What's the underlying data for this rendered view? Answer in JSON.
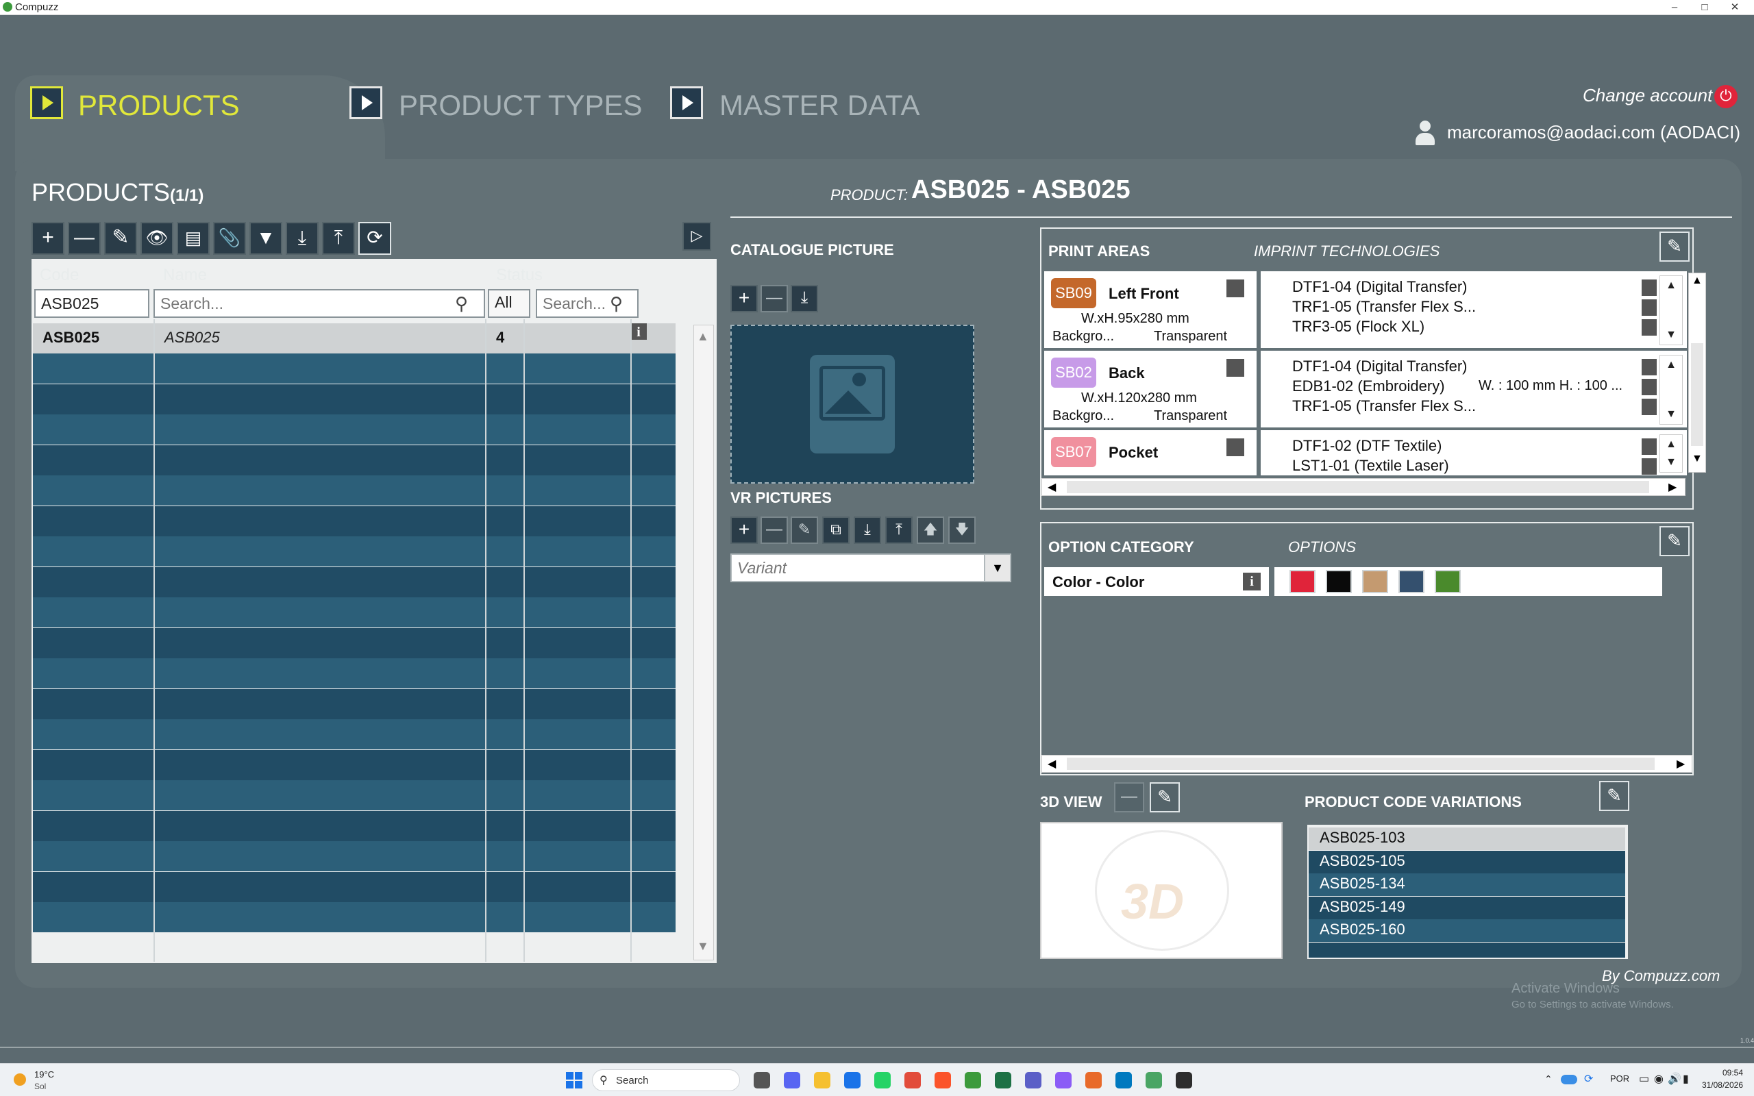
{
  "window": {
    "title": "Compuzz"
  },
  "nav": {
    "tabs": [
      {
        "label": "PRODUCTS",
        "active": true
      },
      {
        "label": "PRODUCT TYPES",
        "active": false
      },
      {
        "label": "MASTER DATA",
        "active": false
      }
    ],
    "change_account": "Change account",
    "user": "marcoramos@aodaci.com (AODACI)"
  },
  "products": {
    "title": "PRODUCTS",
    "count": "(1/1)",
    "columns": {
      "code": "Code",
      "name": "Name",
      "status": "Status"
    },
    "filters": {
      "code": "ASB025",
      "name_placeholder": "Search...",
      "status": "All",
      "extra_placeholder": "Search..."
    },
    "rows": [
      {
        "code": "ASB025",
        "name": "ASB025",
        "status": "4"
      }
    ]
  },
  "product": {
    "label": "PRODUCT:",
    "value": "ASB025 - ASB025"
  },
  "catalogue": {
    "title": "CATALOGUE PICTURE"
  },
  "vr": {
    "title": "VR PICTURES",
    "variant_placeholder": "Variant"
  },
  "print_areas": {
    "title": "PRINT AREAS",
    "subtitle": "IMPRINT TECHNOLOGIES",
    "items": [
      {
        "code": "SB09",
        "color": "#c4682b",
        "name": "Left Front",
        "size": "W.xH.95x280 mm",
        "bg_label": "Backgro...",
        "bg_value": "Transparent",
        "techs": [
          "DTF1-04 (Digital Transfer)",
          "TRF1-05 (Transfer Flex S...",
          "TRF3-05 (Flock XL)"
        ],
        "extra": ""
      },
      {
        "code": "SB02",
        "color": "#c79be8",
        "name": "Back",
        "size": "W.xH.120x280 mm",
        "bg_label": "Backgro...",
        "bg_value": "Transparent",
        "techs": [
          "DTF1-04 (Digital Transfer)",
          "EDB1-02 (Embroidery)",
          "TRF1-05 (Transfer Flex S..."
        ],
        "extra": "W. : 100 mm H. : 100 ..."
      },
      {
        "code": "SB07",
        "color": "#f0909e",
        "name": "Pocket",
        "size": "",
        "bg_label": "",
        "bg_value": "",
        "techs": [
          "DTF1-02 (DTF Textile)",
          "LST1-01 (Textile Laser)"
        ],
        "extra": ""
      }
    ]
  },
  "options": {
    "title": "OPTION CATEGORY",
    "subtitle": "OPTIONS",
    "category": "Color - Color",
    "swatches": [
      "#e0243a",
      "#0a0a0a",
      "#c49a70",
      "#34506e",
      "#4a8a2c"
    ]
  },
  "view3d": {
    "title": "3D VIEW",
    "badge": "3D"
  },
  "pcv": {
    "title": "PRODUCT CODE VARIATIONS",
    "items": [
      "ASB025-103",
      "ASB025-105",
      "ASB025-134",
      "ASB025-149",
      "ASB025-160"
    ]
  },
  "footer": {
    "by": "By Compuzz.com",
    "activate1": "Activate Windows",
    "activate2": "Go to Settings to activate Windows.",
    "version": "1.0.4"
  },
  "taskbar": {
    "temp": "19°C",
    "weather": "Sol",
    "search": "Search",
    "lang": "POR",
    "time": "09:54",
    "date": "31/08/2026"
  }
}
